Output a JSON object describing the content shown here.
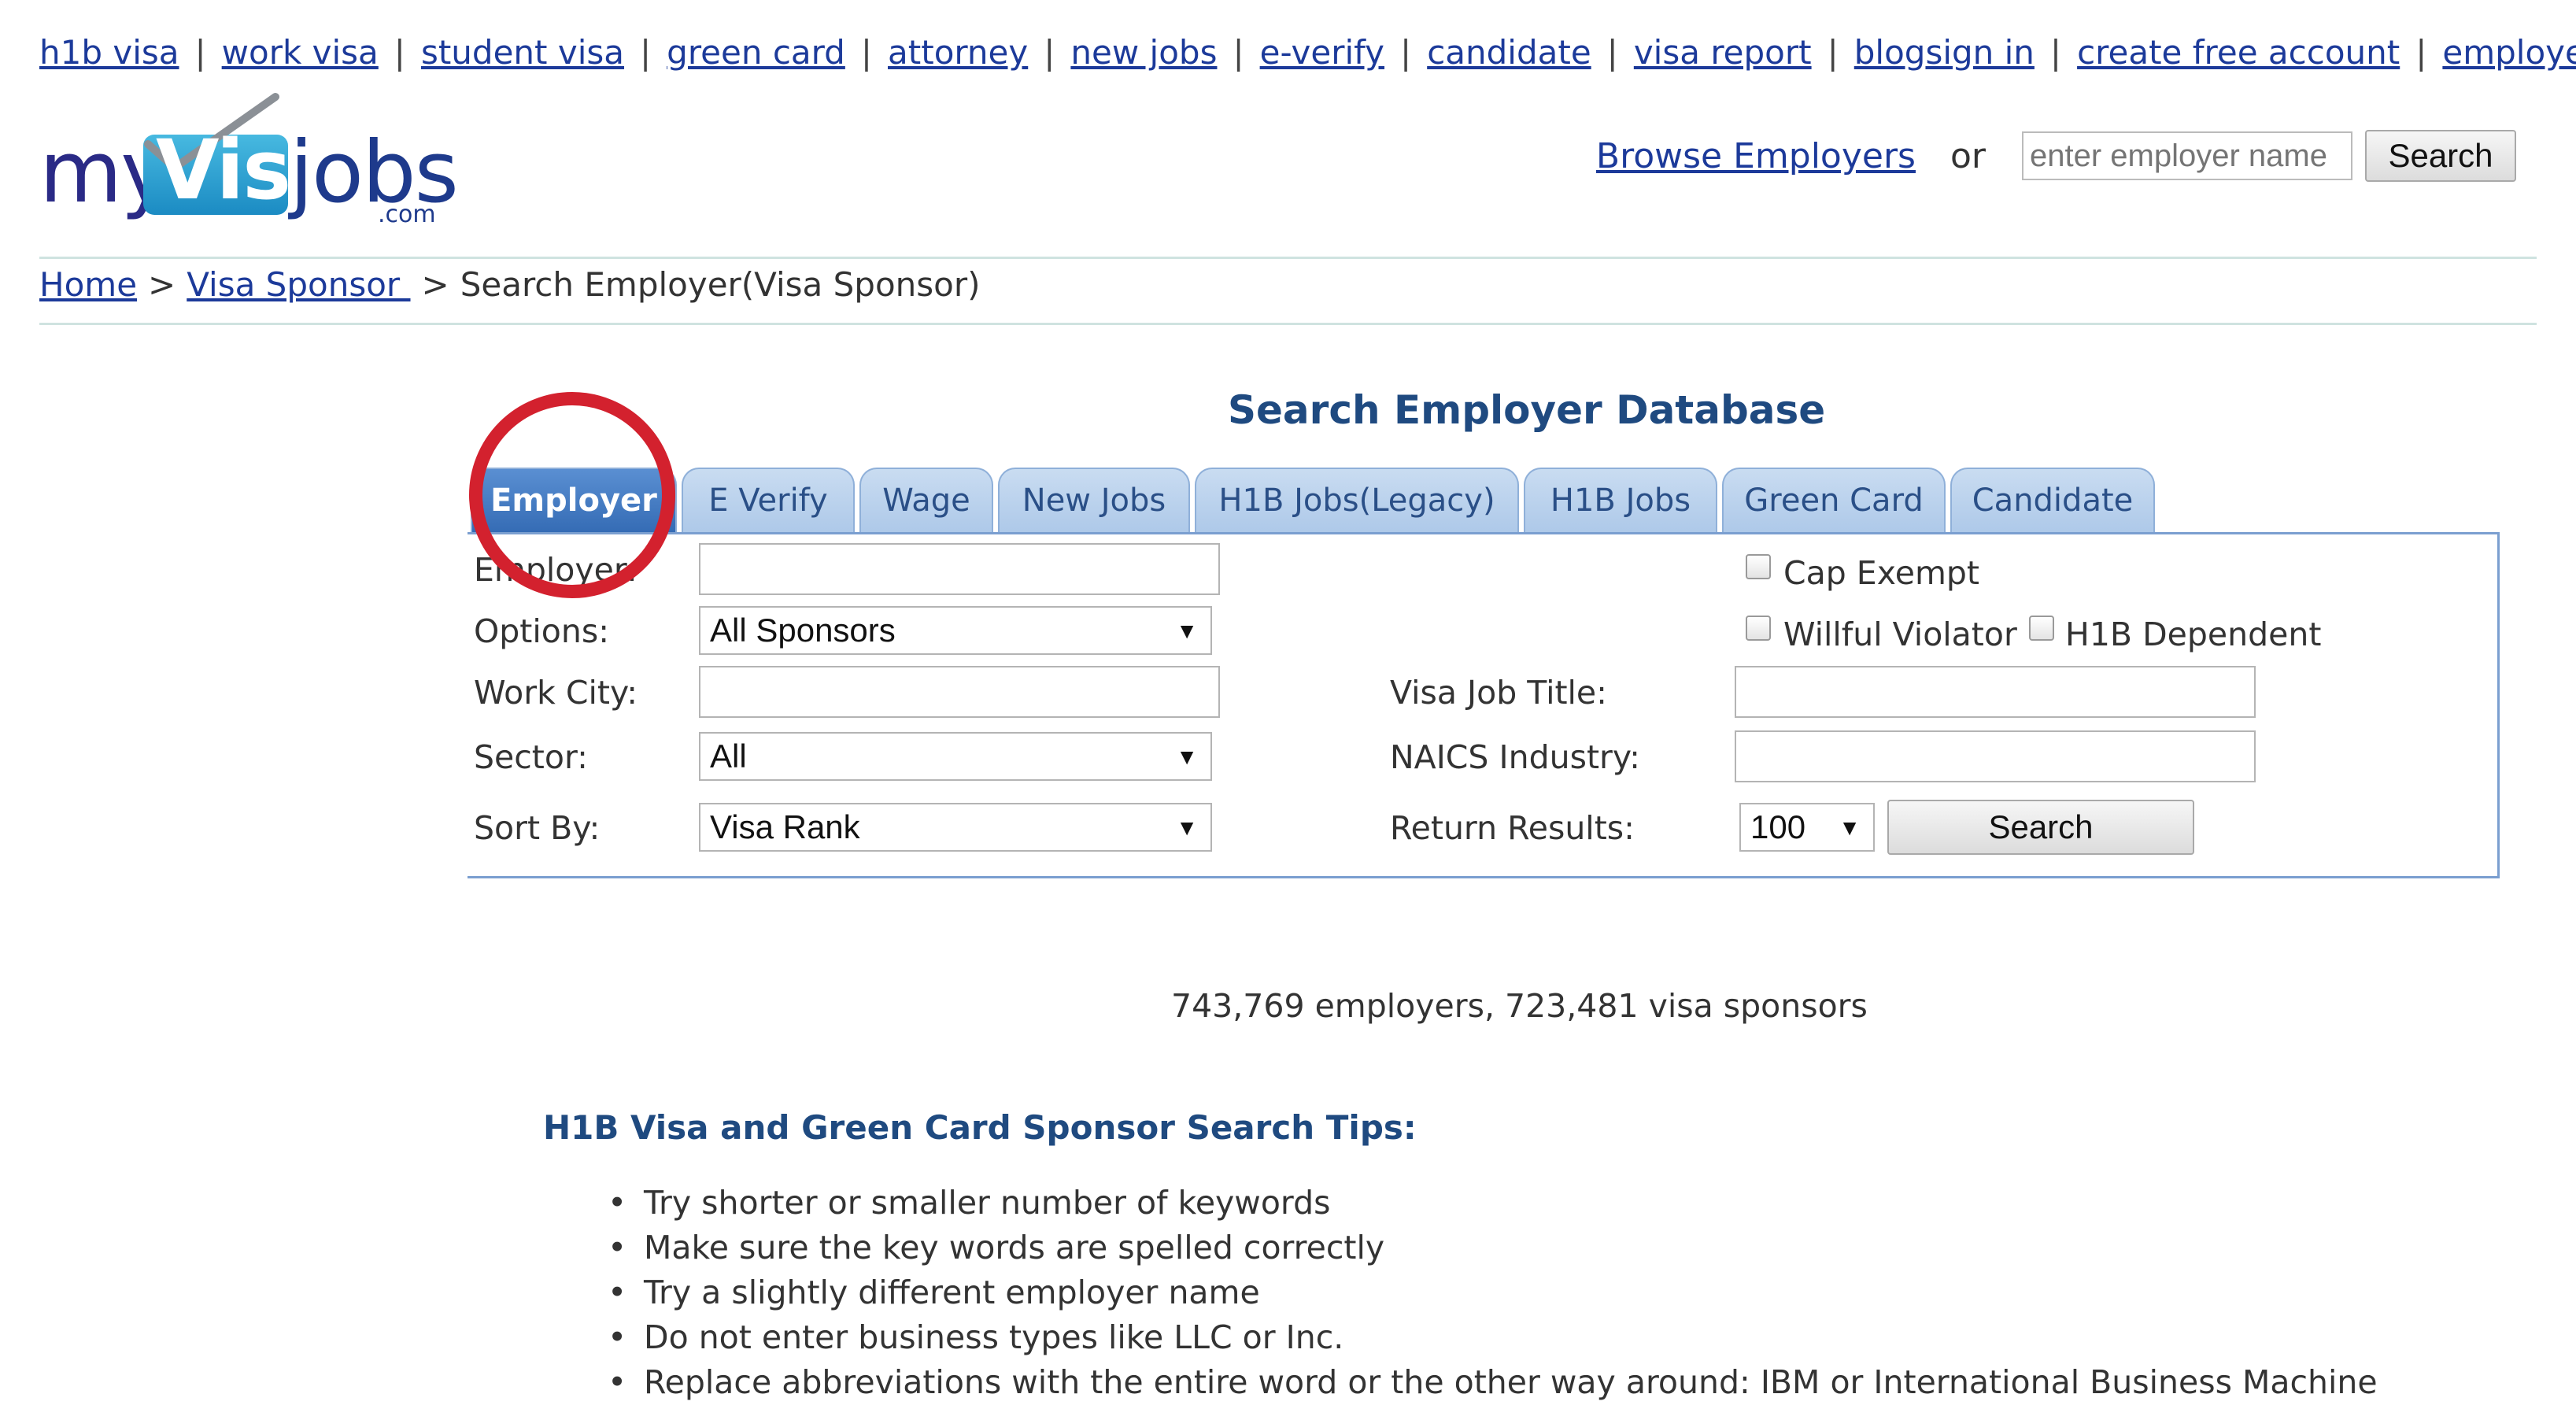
{
  "topnav": {
    "left": [
      "h1b visa",
      "work visa",
      "student visa",
      "green card",
      "attorney",
      "new jobs",
      "e-verify",
      "candidate",
      "visa report",
      "blog"
    ],
    "right": [
      "sign in",
      "create free account",
      "employer"
    ],
    "separator": "|"
  },
  "logo": {
    "my": "my",
    "visa": "Visa",
    "jobs": "jobs",
    "com": ".com"
  },
  "header_search": {
    "browse_link": "Browse Employers",
    "or": "or",
    "placeholder": "enter employer name",
    "button": "Search"
  },
  "breadcrumb": {
    "home": "Home",
    "visa_sponsor": "Visa Sponsor ",
    "current": "Search Employer(Visa Sponsor)",
    "sep": ">"
  },
  "search_panel": {
    "title": "Search Employer Database",
    "tabs": [
      "Employer",
      "E Verify",
      "Wage",
      "New Jobs",
      "H1B Jobs(Legacy)",
      "H1B Jobs",
      "Green Card",
      "Candidate"
    ],
    "active_tab": "Employer",
    "labels": {
      "employer": "Employer:",
      "options": "Options:",
      "work_city": "Work City:",
      "sector": "Sector:",
      "sort_by": "Sort By:",
      "visa_job_title": "Visa Job Title:",
      "naics_industry": "NAICS Industry:",
      "return_results": "Return Results:"
    },
    "selects": {
      "options": "All Sponsors",
      "sector": "All",
      "sort_by": "Visa Rank",
      "return_results": "100"
    },
    "checkboxes": {
      "cap_exempt": "Cap Exempt",
      "willful_violator": "Willful Violator",
      "h1b_dependent": "H1B Dependent"
    },
    "search_button": "Search"
  },
  "stats": "743,769 employers, 723,481 visa sponsors",
  "tips": {
    "title": "H1B Visa and Green Card Sponsor Search Tips:",
    "items": [
      "Try shorter or smaller number of keywords",
      "Make sure the key words are spelled correctly",
      "Try a slightly different employer name",
      "Do not enter business types like LLC or Inc.",
      "Replace abbreviations with the entire word or the other way around: IBM or International Business Machine"
    ]
  },
  "colors": {
    "link": "#1c3a9a",
    "heading": "#1f4a80",
    "tab_active": "#356cb5",
    "tab_inactive": "#aec9e9",
    "annotation_circle": "#d3212e"
  }
}
